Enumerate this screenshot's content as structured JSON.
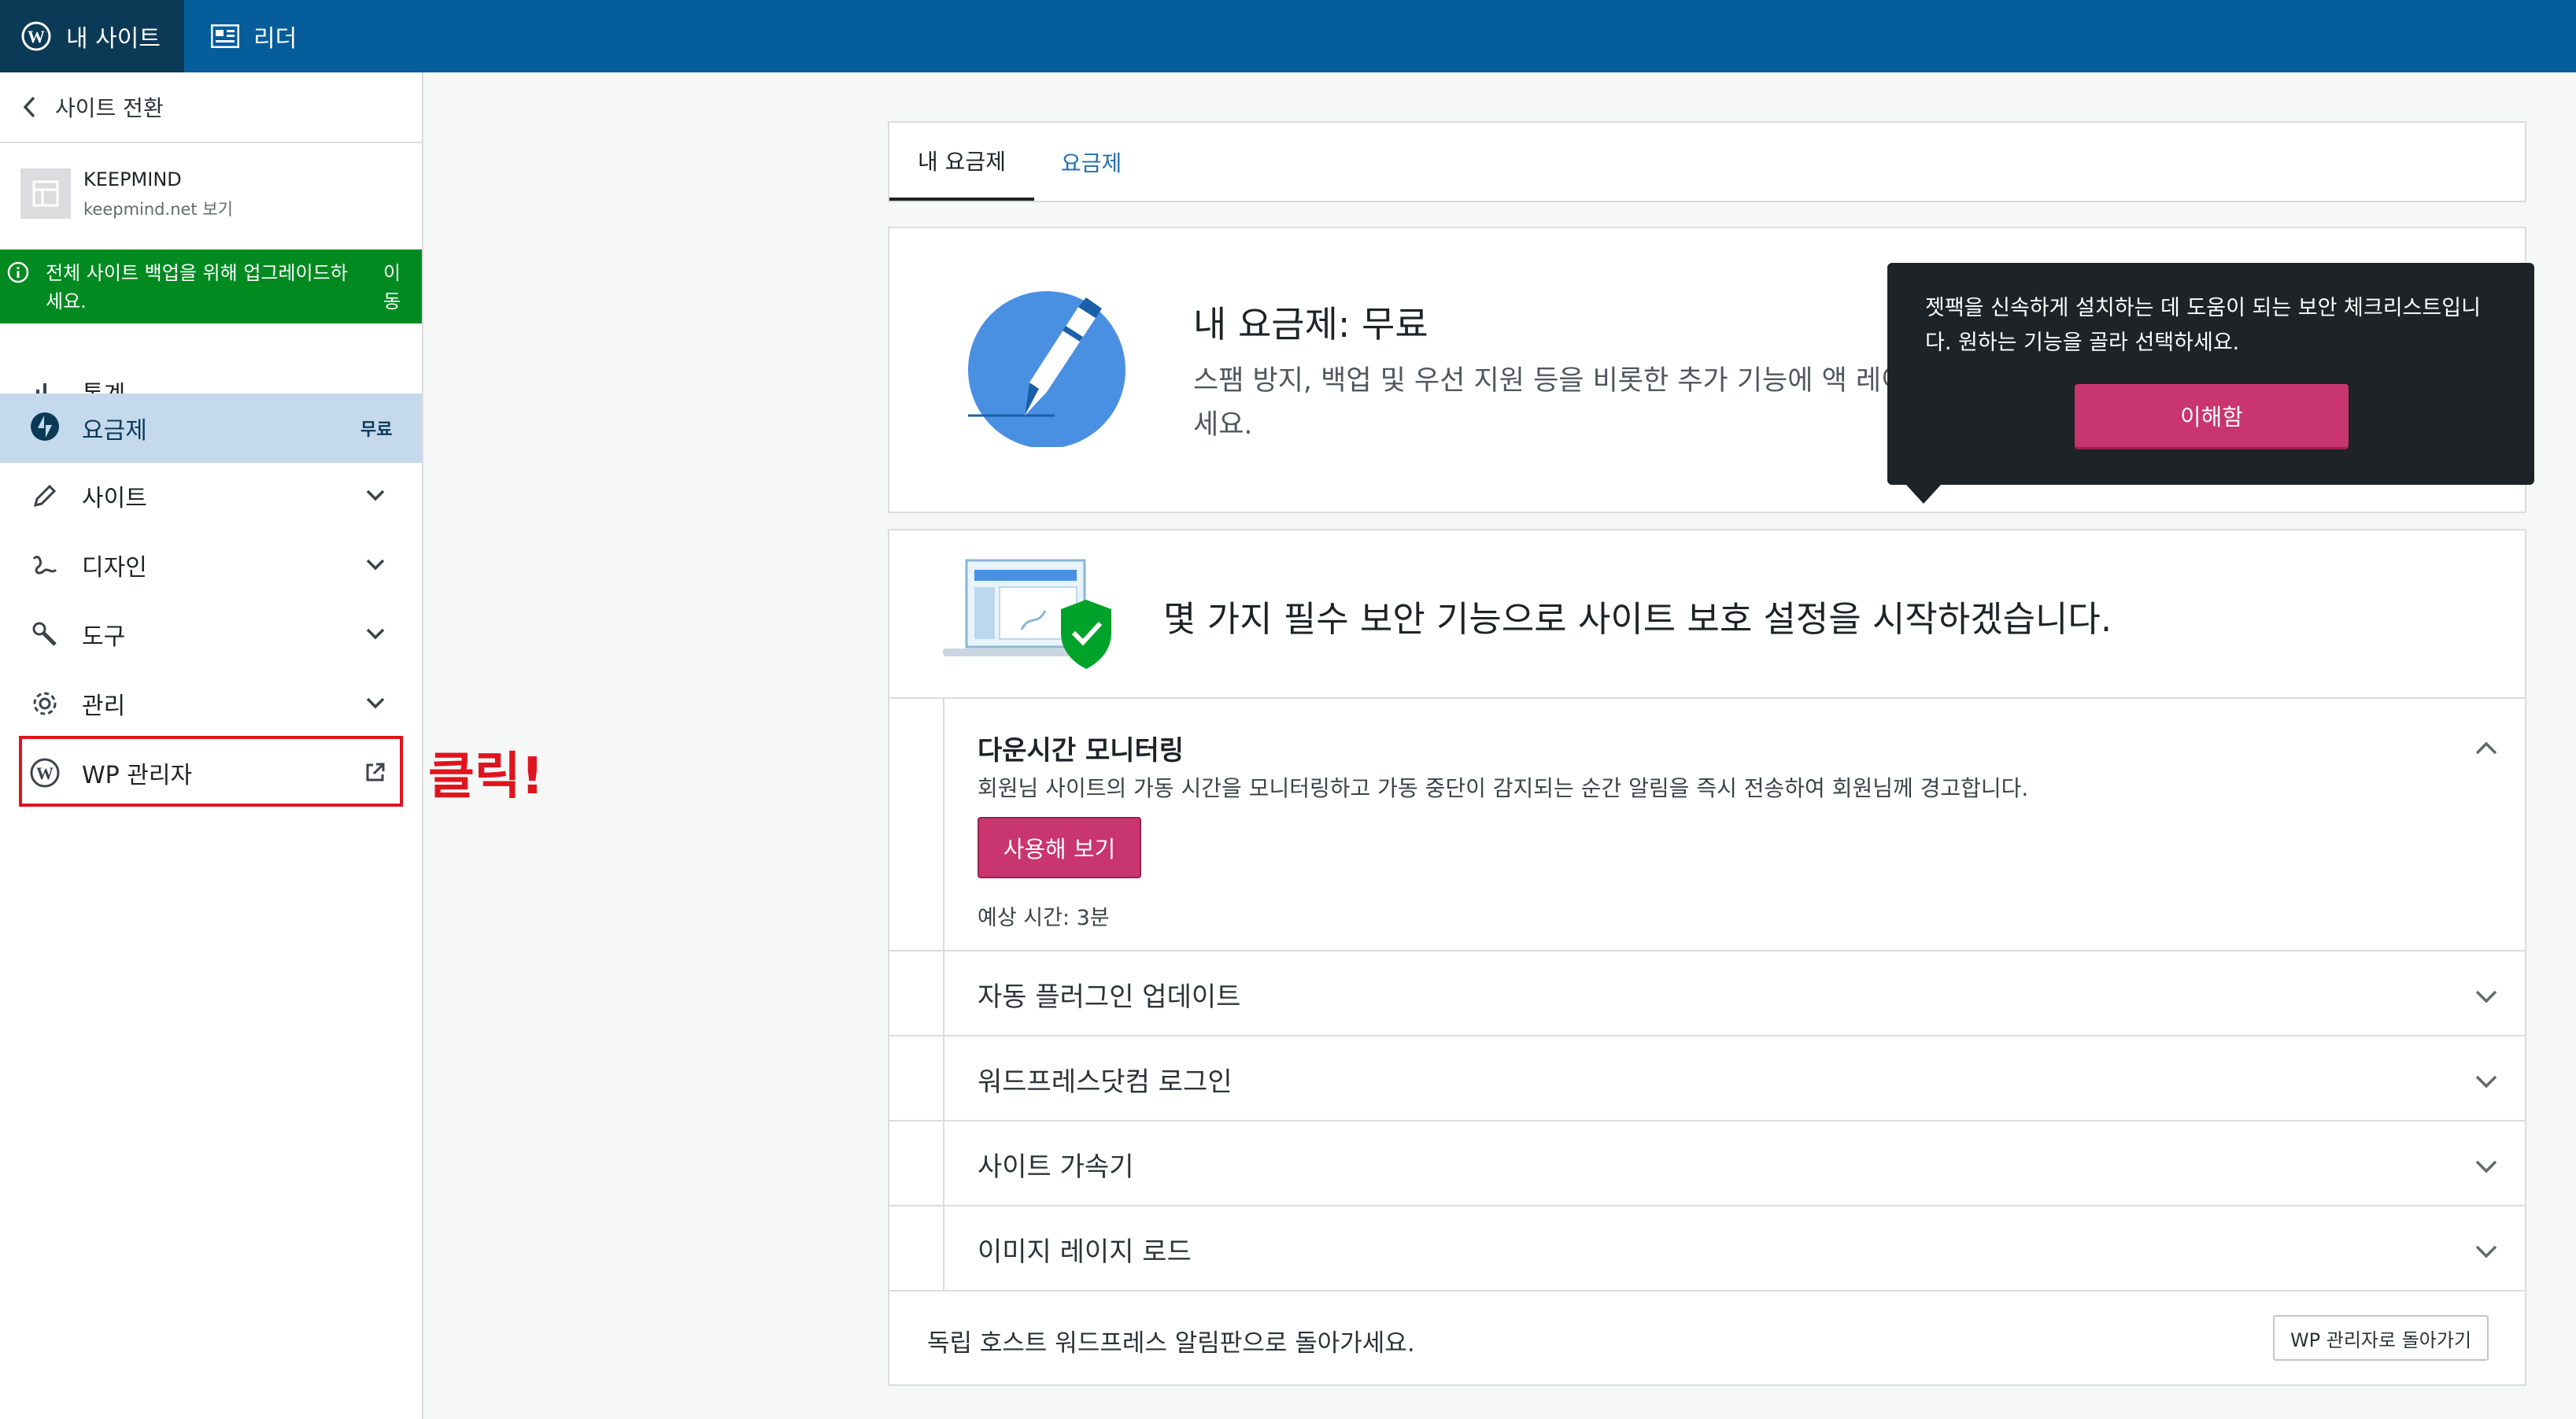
{
  "masterbar": {
    "my_sites": "내 사이트",
    "reader": "리더"
  },
  "sidebar": {
    "switch_site": "사이트 전환",
    "site_name": "KEEPMIND",
    "site_domain": "keepmind.net 보기",
    "upgrade_nudge": {
      "text": "전체 사이트 백업을 위해 업그레이드하세요.",
      "action": "이동"
    },
    "items": [
      {
        "label": "통계",
        "icon": "stats-icon"
      },
      {
        "label": "요금제",
        "icon": "jetpack-icon",
        "badge": "무료",
        "selected": true
      },
      {
        "label": "사이트",
        "icon": "pencil-icon"
      },
      {
        "label": "디자인",
        "icon": "brush-icon"
      },
      {
        "label": "도구",
        "icon": "wrench-icon"
      },
      {
        "label": "관리",
        "icon": "gear-icon"
      },
      {
        "label": "WP 관리자",
        "icon": "wordpress-icon",
        "external": true
      }
    ],
    "annotation": "클릭!"
  },
  "tabs": [
    "내 요금제",
    "요금제"
  ],
  "plan": {
    "title": "내 요금제: 무료",
    "description": "스팸 방지, 백업 및 우선 지원 등을 비롯한 추가 기능에 액 레이드하세요."
  },
  "tooltip": {
    "text": "젯팩을 신속하게 설치하는 데 도움이 되는 보안 체크리스트입니다. 원하는 기능을 골라 선택하세요.",
    "button": "이해함"
  },
  "checklist": {
    "title": "몇 가지 필수 보안 기능으로 사이트 보호 설정을 시작하겠습니다.",
    "tasks": [
      {
        "title": "다운시간 모니터링",
        "description": "회원님 사이트의 가동 시간을 모니터링하고 가동 중단이 감지되는 순간 알림을 즉시 전송하여 회원님께 경고합니다.",
        "button": "사용해 보기",
        "estimate": "예상 시간: 3분",
        "expanded": true
      },
      {
        "title": "자동 플러그인 업데이트"
      },
      {
        "title": "워드프레스닷컴 로그인"
      },
      {
        "title": "사이트 가속기"
      },
      {
        "title": "이미지 레이지 로드"
      }
    ],
    "footer_text": "독립 호스트 워드프레스 알림판으로 돌아가세요.",
    "return_button": "WP 관리자로 돌아가기"
  },
  "colors": {
    "masterbar": "#055d9c",
    "masterbar_active": "#0b3a57",
    "nudge_green": "#008a20",
    "selected_nav": "#c5d9ed",
    "accent_pink": "#c9356e",
    "highlight_red": "#e0141e",
    "link_blue": "#2271b1"
  }
}
